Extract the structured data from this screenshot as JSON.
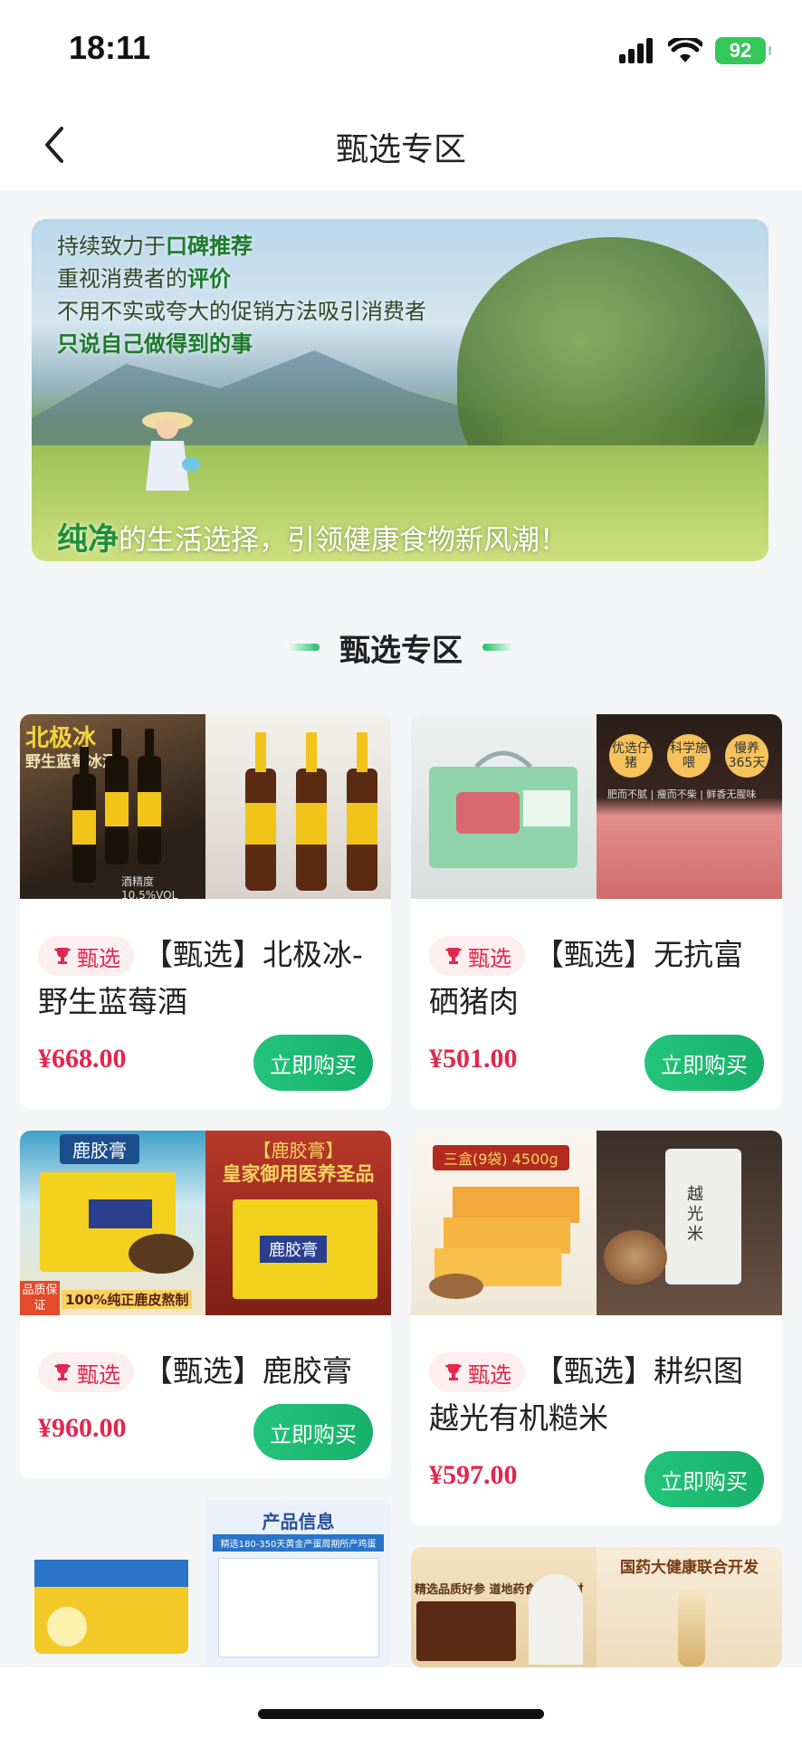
{
  "status_bar": {
    "time": "18:11",
    "battery": "92"
  },
  "nav": {
    "title": "甄选专区",
    "back_icon": "chevron-left-icon"
  },
  "banner": {
    "line1_prefix": "持续致力于",
    "line1_highlight": "口碑推荐",
    "line2_prefix": "重视消费者的",
    "line2_highlight": "评价",
    "line3": "不用不实或夸大的促销方法吸引消费者",
    "line4": "只说自己做得到的事",
    "slogan_highlight": "纯净",
    "slogan_rest": "的生活选择，引领健康食物新风潮！"
  },
  "section": {
    "title": "甄选专区"
  },
  "tag_label": "甄选",
  "buy_label": "立即购买",
  "products": [
    {
      "name": "【甄选】北极冰-野生蓝莓酒",
      "price": "¥668.00",
      "img_title": "北极冰",
      "img_sub": "野生蓝莓冰酒",
      "img_note": "酒精度10.5%VOL"
    },
    {
      "name": "【甄选】无抗富硒猪肉",
      "price": "¥501.00",
      "img_badges": [
        "优选仔猪",
        "科学施喂",
        "慢养365天"
      ],
      "img_note": "肥而不腻 | 瘦而不柴 | 鲜香无腥味"
    },
    {
      "name": "【甄选】鹿胶膏",
      "price": "¥960.00",
      "img_title": "鹿胶膏",
      "img_right_title": "【鹿胶膏】",
      "img_right_sub": "皇家御用医养圣品",
      "img_badge": "品质保证",
      "img_note": "100%纯正鹿皮熬制",
      "img_box": "鹿胶膏"
    },
    {
      "name": "【甄选】耕织图越光有机糙米",
      "price": "¥597.00",
      "img_title": "三盒(9袋) 4500g",
      "img_bag": "越光米"
    },
    {
      "img_right_title": "产品信息",
      "img_right_sub": "精选180-350天黄金产蛋周期所产鸡蛋"
    },
    {
      "img_right_title": "国药大健康联合开发",
      "img_left_sub": "精选品质好参 道地药食同源食材"
    }
  ],
  "colors": {
    "accent": "#1dbf6b",
    "price": "#e3264d",
    "tag_bg": "#fdeef0"
  }
}
